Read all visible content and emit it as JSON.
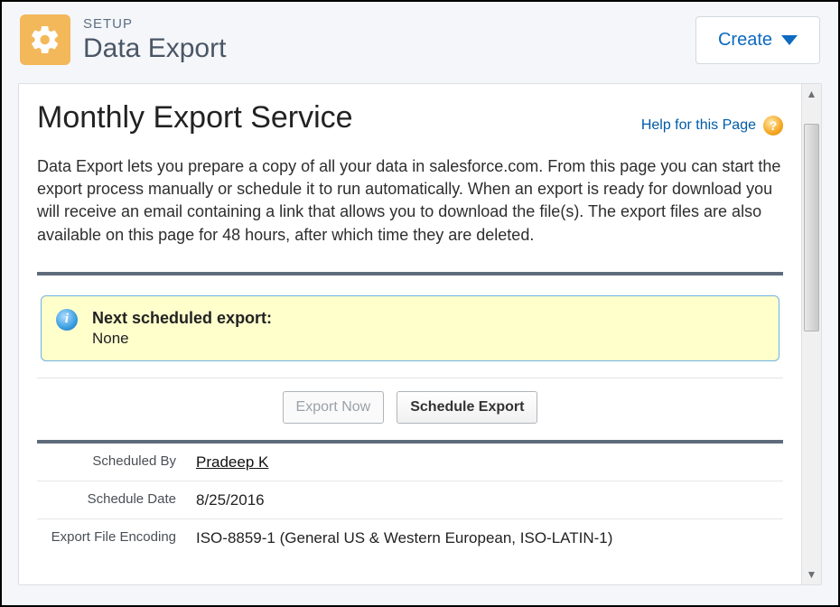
{
  "header": {
    "setup_label": "SETUP",
    "page_title": "Data Export",
    "create_label": "Create"
  },
  "panel": {
    "title": "Monthly Export Service",
    "help_label": "Help for this Page",
    "description": "Data Export lets you prepare a copy of all your data in salesforce.com. From this page you can start the export process manually or schedule it to run automatically. When an export is ready for download you will receive an email containing a link that allows you to download the file(s). The export files are also available on this page for 48 hours, after which time they are deleted."
  },
  "info": {
    "title": "Next scheduled export:",
    "value": "None"
  },
  "actions": {
    "export_now": "Export Now",
    "schedule_export": "Schedule Export"
  },
  "details": {
    "scheduled_by_label": "Scheduled By",
    "scheduled_by": "Pradeep K",
    "schedule_date_label": "Schedule Date",
    "schedule_date": "8/25/2016",
    "encoding_label": "Export File Encoding",
    "encoding": "ISO-8859-1 (General US & Western European, ISO-LATIN-1)"
  }
}
